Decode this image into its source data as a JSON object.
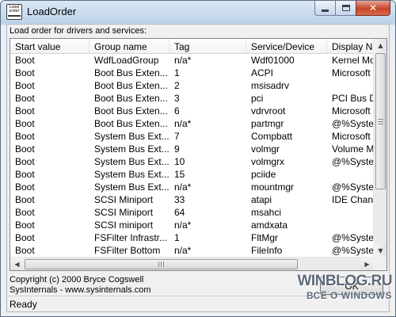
{
  "window": {
    "title": "LoadOrder",
    "app_icon_text": "Load order"
  },
  "group_label": "Load order for drivers and services:",
  "listview": {
    "columns": [
      "Start value",
      "Group name",
      "Tag",
      "Service/Device",
      "Display Na"
    ],
    "rows": [
      [
        "Boot",
        "WdfLoadGroup",
        "n/a*",
        "Wdf01000",
        "Kernel Mo"
      ],
      [
        "Boot",
        "Boot Bus Exten...",
        "1",
        "ACPI",
        "Microsoft"
      ],
      [
        "Boot",
        "Boot Bus Exten...",
        "2",
        "msisadrv",
        ""
      ],
      [
        "Boot",
        "Boot Bus Exten...",
        "3",
        "pci",
        "PCI Bus Dr"
      ],
      [
        "Boot",
        "Boot Bus Exten...",
        "6",
        "vdrvroot",
        "Microsoft"
      ],
      [
        "Boot",
        "Boot Bus Exten...",
        "n/a*",
        "partmgr",
        "@%System"
      ],
      [
        "Boot",
        "System Bus Ext...",
        "7",
        "Compbatt",
        "Microsoft"
      ],
      [
        "Boot",
        "System Bus Ext...",
        "9",
        "volmgr",
        "Volume M"
      ],
      [
        "Boot",
        "System Bus Ext...",
        "10",
        "volmgrx",
        "@%System"
      ],
      [
        "Boot",
        "System Bus Ext...",
        "15",
        "pciide",
        ""
      ],
      [
        "Boot",
        "System Bus Ext...",
        "n/a*",
        "mountmgr",
        "@%System"
      ],
      [
        "Boot",
        "SCSI Miniport",
        "33",
        "atapi",
        "IDE Chann"
      ],
      [
        "Boot",
        "SCSI Miniport",
        "64",
        "msahci",
        ""
      ],
      [
        "Boot",
        "SCSI miniport",
        "n/a*",
        "amdxata",
        ""
      ],
      [
        "Boot",
        "FSFilter Infrastr...",
        "1",
        "FltMgr",
        "@%System"
      ],
      [
        "Boot",
        "FSFilter Bottom",
        "n/a*",
        "FileInfo",
        "@%System"
      ]
    ]
  },
  "copyright": {
    "line1": "Copyright (c) 2000 Bryce Cogswell",
    "line2": "SysInternals - www.sysinternals.com"
  },
  "ok_button": {
    "label": "OK"
  },
  "status": {
    "text": "Ready"
  },
  "watermark": {
    "main": "WINBLOG.RU",
    "sub": "ВСЁ О WINDOWS"
  },
  "icons": {
    "minimize": "minimize-icon",
    "maximize": "maximize-icon",
    "close": "close-icon",
    "scroll_up": "▲",
    "scroll_down": "▼",
    "scroll_left": "◀",
    "scroll_right": "▶"
  },
  "scroll": {
    "vertical_position": 0.0,
    "horizontal_position": 0.0
  }
}
